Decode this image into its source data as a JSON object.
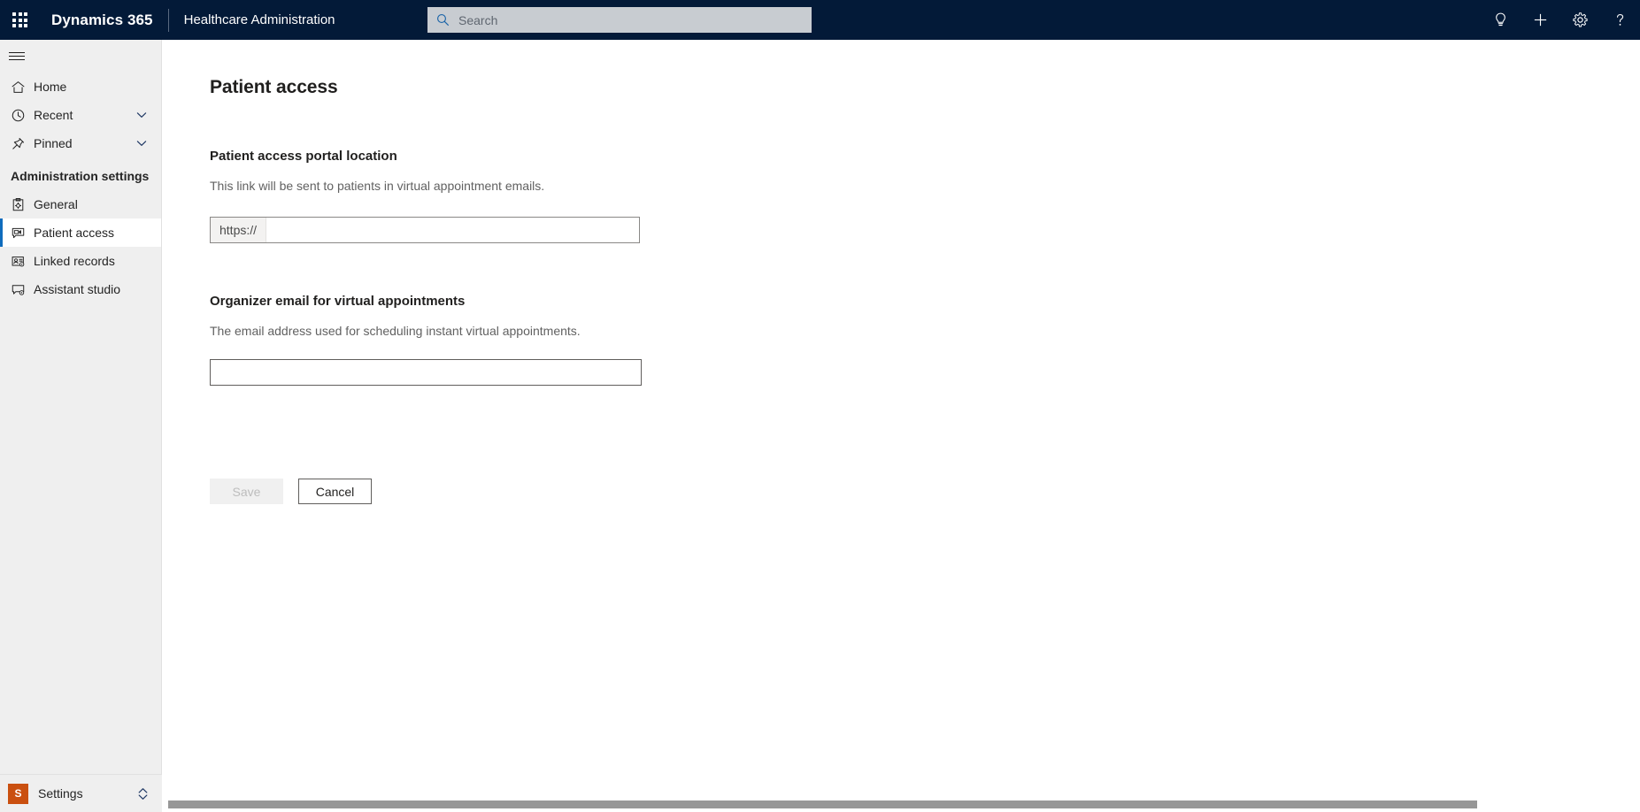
{
  "topnav": {
    "waffle_label": "app-launcher",
    "brand": "Dynamics 365",
    "app_name": "Healthcare Administration",
    "search": {
      "placeholder": "Search",
      "value": ""
    },
    "icons": [
      {
        "name": "lightbulb-icon",
        "title": "Ideas"
      },
      {
        "name": "plus-icon",
        "title": "Quick create"
      },
      {
        "name": "gear-icon",
        "title": "Settings"
      },
      {
        "name": "question-icon",
        "title": "Help"
      }
    ],
    "colors": {
      "background": "#031a38",
      "search_background": "#c8ccd1",
      "search_icon": "#1b64a8"
    }
  },
  "sidebar": {
    "hamburger_label": "Site map",
    "items": [
      {
        "label": "Home",
        "icon": "home-icon",
        "expandable": false,
        "selected": false
      },
      {
        "label": "Recent",
        "icon": "clock-icon",
        "expandable": true,
        "selected": false
      },
      {
        "label": "Pinned",
        "icon": "pin-icon",
        "expandable": true,
        "selected": false
      }
    ],
    "group": {
      "title": "Administration settings",
      "items": [
        {
          "label": "General",
          "icon": "clipboard-gear-icon",
          "selected": false
        },
        {
          "label": "Patient access",
          "icon": "video-chat-icon",
          "selected": true
        },
        {
          "label": "Linked records",
          "icon": "contact-card-gear-icon",
          "selected": false
        },
        {
          "label": "Assistant studio",
          "icon": "screen-gear-icon",
          "selected": false
        }
      ]
    },
    "footer": {
      "badge": "S",
      "label": "Settings",
      "chevron": "updown-chevron-icon",
      "badge_color": "#ca5010"
    },
    "colors": {
      "background": "#efefef",
      "selected_background": "#ffffff",
      "selected_accent": "#0f6cbd"
    }
  },
  "main": {
    "page_title": "Patient access",
    "sections": [
      {
        "title": "Patient access portal location",
        "description": "This link will be sent to patients in virtual appointment emails.",
        "field": {
          "type": "url",
          "prefix": "https://",
          "value": "",
          "placeholder": ""
        }
      },
      {
        "title": "Organizer email for virtual appointments",
        "description": "The email address used for scheduling instant virtual appointments.",
        "field": {
          "type": "email",
          "value": "",
          "placeholder": ""
        }
      }
    ],
    "buttons": {
      "save": {
        "label": "Save",
        "disabled": true
      },
      "cancel": {
        "label": "Cancel",
        "disabled": false
      }
    }
  },
  "scrollbar": {
    "orientation": "horizontal",
    "thumb_color": "#979797"
  }
}
